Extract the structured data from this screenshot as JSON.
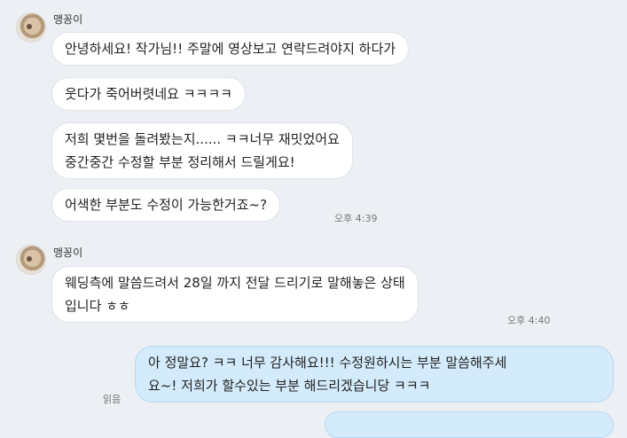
{
  "groups": [
    {
      "sender": "맹꽁이",
      "messages": [
        "안녕하세요! 작가님!! 주말에 영상보고 연락드려야지 하다가",
        "웃다가 죽어버렷네요 ㅋㅋㅋㅋ",
        "저희 몇번을 돌려봤는지...... ㅋㅋ너무 재밋었어요",
        "중간중간 수정할 부분 정리해서 드릴게요!",
        "어색한 부분도 수정이 가능한거죠~?"
      ],
      "time": "오후 4:39"
    },
    {
      "sender": "맹꽁이",
      "messages": [
        "웨딩측에 말씀드려서 28일 까지 전달 드리기로 말해놓은 상태",
        "입니다 ㅎㅎ"
      ],
      "time": "오후 4:40"
    }
  ],
  "outgoing": {
    "lines": [
      "아 정말요? ㅋㅋ 너무 감사해요!!! 수정원하시는 부분 말씀해주세",
      "요~! 저희가 할수있는 부분 해드리겠습니당 ㅋㅋㅋ"
    ],
    "read_status": "읽음"
  }
}
